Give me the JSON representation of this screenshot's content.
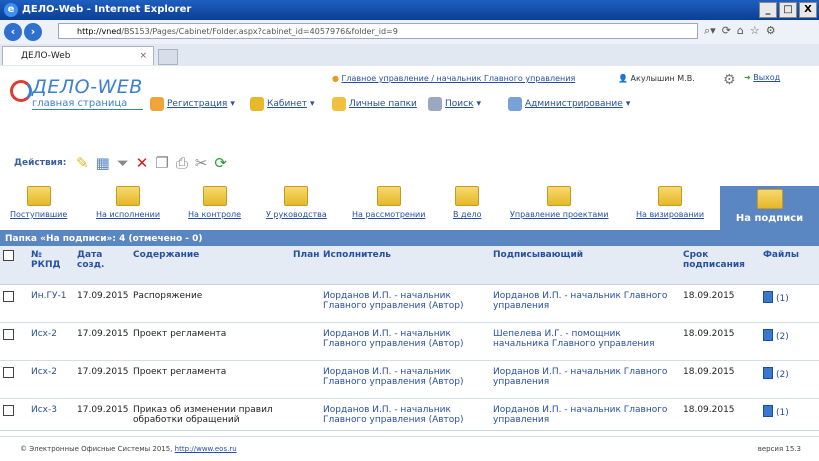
{
  "window": {
    "title": "ДЕЛО-Web - Internet Explorer",
    "minimize": "_",
    "restore": "□",
    "close": "X"
  },
  "browser": {
    "url_host": "http://vned",
    "url_path": "/BS153/Pages/Cabinet/Folder.aspx?cabinet_id=4057976&folder_id=9",
    "tab_label": "ДЕЛО-Web"
  },
  "app": {
    "logo_word": "ДЕЛО-WEB",
    "logo_sub": "главная страница",
    "path_link": "Главное управление / начальник Главного управления",
    "user_name": "Акулышин М.В.",
    "exit_label": "Выход",
    "menu": [
      {
        "label": "Регистрация",
        "icon": "pencil-icon"
      },
      {
        "label": "Кабинет",
        "icon": "cabinet-icon"
      },
      {
        "label": "Личные папки",
        "icon": "folders-icon"
      },
      {
        "label": "Поиск",
        "icon": "search-icon"
      },
      {
        "label": "Администрирование",
        "icon": "admin-icon"
      }
    ],
    "actions_label": "Действия:"
  },
  "folders": [
    "Поступившие",
    "На исполнении",
    "На контроле",
    "У руководства",
    "На рассмотрении",
    "В дело",
    "Управление проектами",
    "На визировании"
  ],
  "active_folder": "На подписи",
  "caption": "Папка «На подписи»: 4 (отмечено - 0)",
  "table": {
    "headers": {
      "num": "№ РКПД",
      "date": "Дата созд.",
      "content": "Содержание",
      "plan": "План",
      "executor": "Исполнитель",
      "signer": "Подписывающий",
      "deadline": "Срок подписания",
      "files": "Файлы"
    },
    "rows": [
      {
        "num": "Ин.ГУ-1",
        "date": "17.09.2015",
        "content": "Распоряжение",
        "executor": "Иорданов И.П. - начальник Главного управления (Автор)",
        "signer": "Иорданов И.П. - начальник Главного управления",
        "deadline": "18.09.2015",
        "files": "(1)"
      },
      {
        "num": "Исх-2",
        "date": "17.09.2015",
        "content": "Проект регламента",
        "executor": "Иорданов И.П. - начальник Главного управления (Автор)",
        "signer": "Шепелева И.Г. - помощник начальника Главного управления",
        "deadline": "18.09.2015",
        "files": "(2)"
      },
      {
        "num": "Исх-2",
        "date": "17.09.2015",
        "content": "Проект регламента",
        "executor": "Иорданов И.П. - начальник Главного управления (Автор)",
        "signer": "Иорданов И.П. - начальник Главного управления",
        "deadline": "18.09.2015",
        "files": "(2)"
      },
      {
        "num": "Исх-3",
        "date": "17.09.2015",
        "content": "Приказ об изменении правил обработки обращений",
        "executor": "Иорданов И.П. - начальник Главного управления (Автор)",
        "signer": "Иорданов И.П. - начальник Главного управления",
        "deadline": "18.09.2015",
        "files": "(1)"
      }
    ]
  },
  "footer": {
    "copyright": "© Электронные Офисные Системы 2015,",
    "link": "http://www.eos.ru",
    "version": "версия 15.3"
  }
}
